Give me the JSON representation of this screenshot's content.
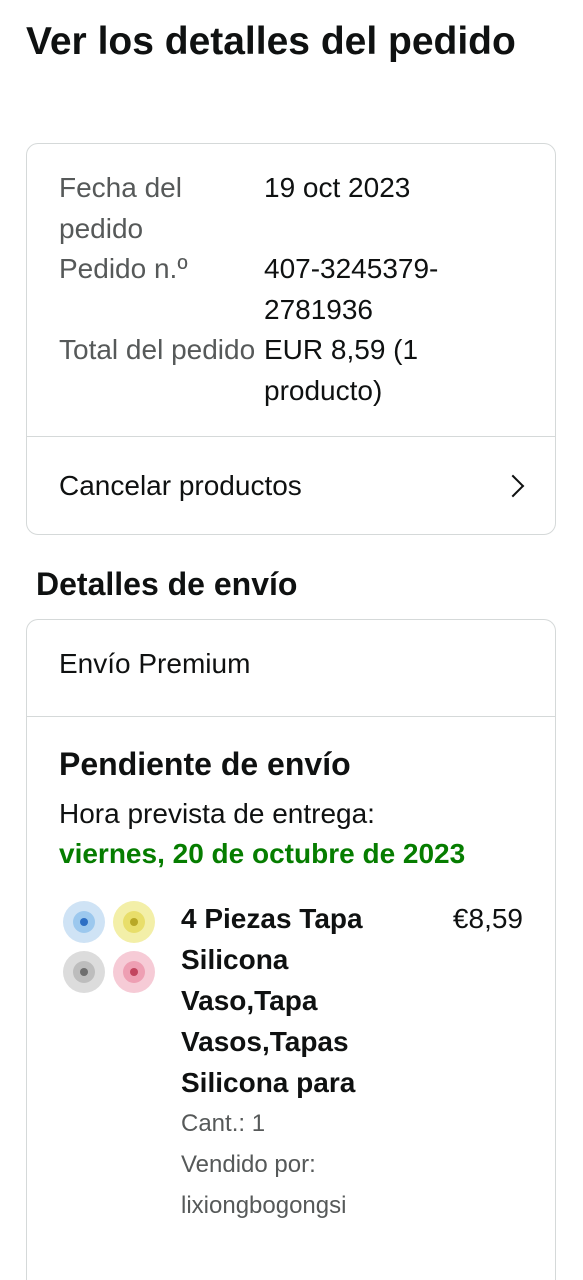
{
  "page": {
    "title": "Ver los detalles del pedido"
  },
  "summary": {
    "date_label": "Fecha del pedido",
    "date_value": "19 oct 2023",
    "order_label": "Pedido n.º",
    "order_value": "407-3245379-2781936",
    "total_label": "Total del pedido",
    "total_value": "EUR 8,59 (1 producto)",
    "cancel_label": "Cancelar productos"
  },
  "shipping": {
    "section_title": "Detalles de envío",
    "type": "Envío Premium",
    "status": "Pendiente de envío",
    "eta_label": "Hora prevista de entrega:",
    "eta_date": "viernes, 20 de octubre de 2023",
    "accent_color": "#067d00"
  },
  "item": {
    "title": "4 Piezas Tapa Silicona Vaso,Tapa Vasos,Tapas Silicona para",
    "price": "€8,59",
    "quantity": "Cant.: 1",
    "sold_by_label": "Vendido por:",
    "seller": "lixiongbogongsi",
    "image_icon": "silicone-lids-image"
  }
}
